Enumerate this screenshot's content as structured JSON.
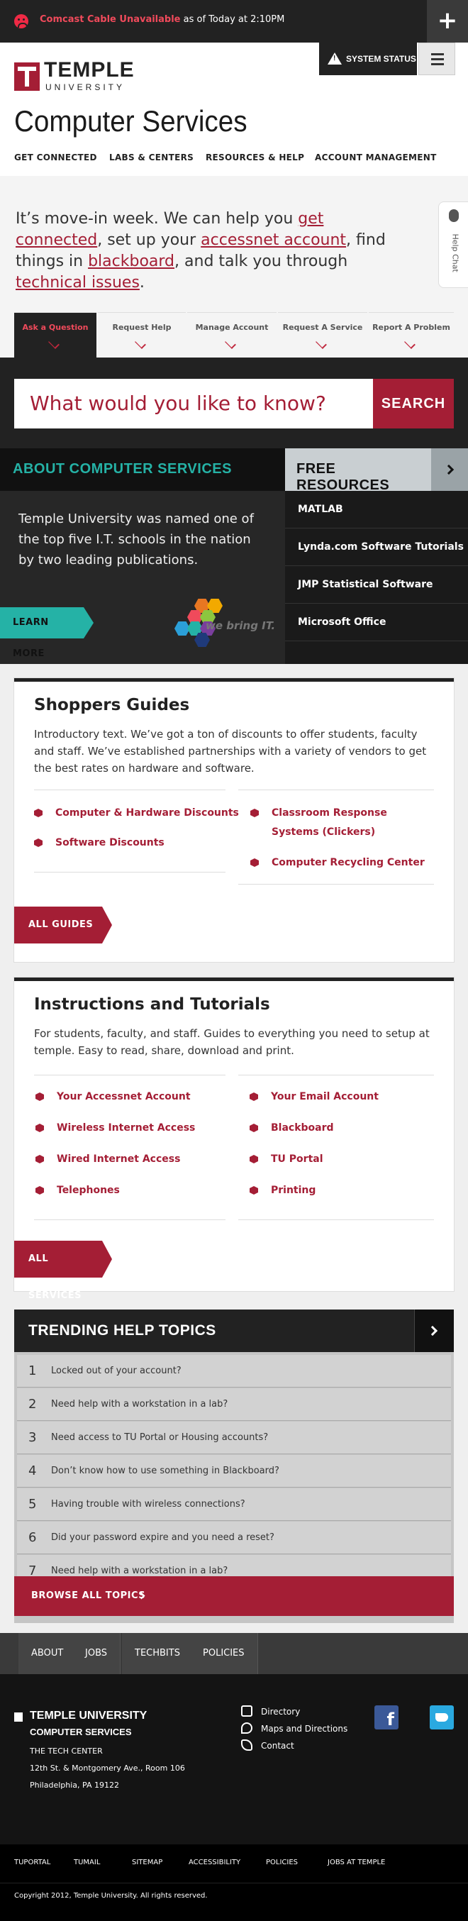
{
  "alert": {
    "title": "Comcast Cable Unavailable",
    "rest": " as of Today at 2:10PM"
  },
  "header": {
    "logo_word": "TEMPLE",
    "logo_sub": "UNIVERSITY",
    "site_title": "Computer Services",
    "status_label": "SYSTEM STATUS",
    "nav": [
      "GET CONNECTED",
      "LABS & CENTERS",
      "RESOURCES & HELP",
      "ACCOUNT MANAGEMENT"
    ]
  },
  "intro": {
    "t1": "It’s move-in week. We can help you ",
    "l1": "get connected",
    "t2": ", set up your ",
    "l2": "accessnet account",
    "t3": ", find things in ",
    "l3": "blackboard",
    "t4": ", and talk you through ",
    "l4": "technical issues",
    "t5": "."
  },
  "help_chat": "Help Chat",
  "tabs": [
    "Ask a Question",
    "Request Help",
    "Manage Account",
    "Request A Service",
    "Report A Problem"
  ],
  "search": {
    "placeholder": "What would you like to know?",
    "button": "SEARCH"
  },
  "about": {
    "title": "ABOUT COMPUTER SERVICES",
    "text": "Temple University was named one of the top five I.T. schools in the nation by two leading publications.",
    "button": "LEARN MORE",
    "tagline": "we bring IT."
  },
  "free_resources": {
    "title": "FREE RESOURCES",
    "items": [
      "MATLAB",
      "Lynda.com Software Tutorials",
      "JMP Statistical Software",
      "Microsoft Office"
    ]
  },
  "shoppers": {
    "title": "Shoppers Guides",
    "text": "Introductory text. We’ve got a ton of discounts to offer students, faculty and staff. We’ve established partnerships with a variety of vendors to get the best rates on hardware and software.",
    "left": [
      "Computer & Hardware Discounts",
      "Software Discounts"
    ],
    "right": [
      "Classroom Response Systems (Clickers)",
      "Computer Recycling Center"
    ],
    "button": "ALL GUIDES"
  },
  "instructions": {
    "title": "Instructions and Tutorials",
    "text": "For students, faculty, and staff. Guides to everything you need to setup at temple. Easy to read, share, download and print.",
    "left": [
      "Your Accessnet Account",
      "Wireless Internet Access",
      "Wired Internet Access",
      "Telephones"
    ],
    "right": [
      "Your Email Account",
      "Blackboard",
      "TU Portal",
      "Printing"
    ],
    "button": "ALL SERVICES"
  },
  "trending": {
    "title": "TRENDING HELP TOPICS",
    "items": [
      {
        "n": "1",
        "q": "Locked out of your account?"
      },
      {
        "n": "2",
        "q": "Need help with a workstation in a lab?"
      },
      {
        "n": "3",
        "q": "Need access to TU Portal or Housing accounts?"
      },
      {
        "n": "4",
        "q": "Don’t know how to use something in Blackboard?"
      },
      {
        "n": "5",
        "q": "Having trouble with wireless connections?"
      },
      {
        "n": "6",
        "q": "Did your password expire and you need a reset?"
      },
      {
        "n": "7",
        "q": "Need help with a workstation in a lab?"
      }
    ],
    "browse": "BROWSE ALL TOPICS"
  },
  "footer_nav": [
    "ABOUT",
    "JOBS",
    "TECHBITS",
    "POLICIES"
  ],
  "footer": {
    "name": "TEMPLE UNIVERSITY",
    "dept": "COMPUTER SERVICES",
    "line1": "THE TECH CENTER",
    "line2": "12th St. & Montgomery Ave., Room 106",
    "line3": "Philadelphia, PA 19122",
    "links": [
      "Directory",
      "Maps and Directions",
      "Contact"
    ],
    "fb": "f"
  },
  "bottom_links": [
    "TUPORTAL",
    "TUMAIL",
    "SITEMAP",
    "ACCESSIBILITY",
    "POLICIES",
    "JOBS AT TEMPLE"
  ],
  "copyright": "Copyright 2012, Temple University. All rights reserved.",
  "colors": {
    "cherry": "#a41e35",
    "teal": "#25b2a6",
    "dark": "#222222"
  }
}
